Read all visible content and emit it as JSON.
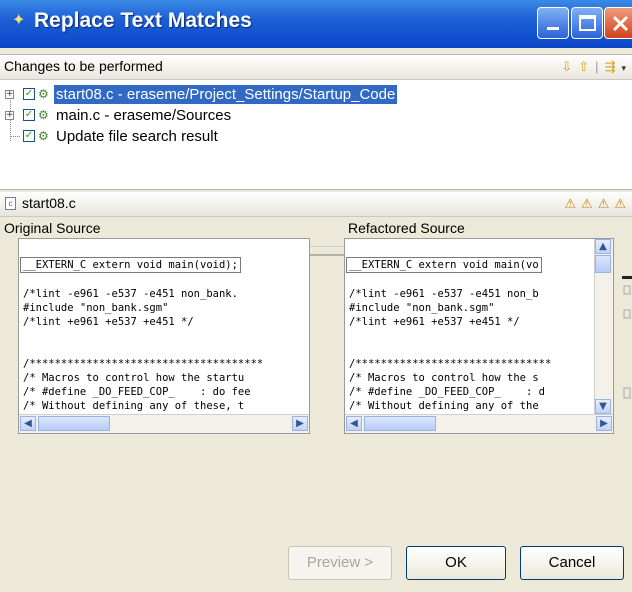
{
  "window": {
    "title": "Replace Text Matches"
  },
  "changes": {
    "header": "Changes to be performed",
    "items": [
      {
        "label": "start08.c - eraseme/Project_Settings/Startup_Code",
        "checked": true,
        "selected": true
      },
      {
        "label": "main.c - eraseme/Sources",
        "checked": true,
        "selected": false
      },
      {
        "label": "Update file search result",
        "checked": true,
        "selected": false
      }
    ]
  },
  "compare": {
    "file_name": "start08.c",
    "left_title": "Original Source",
    "right_title": "Refactored Source",
    "left_lines": [
      "__EXTERN_C extern void main(void);",
      "",
      "/*lint -e961 -e537 -e451 non_bank.",
      "#include \"non_bank.sgm\"",
      "/*lint +e961 +e537 +e451 */",
      "",
      "",
      "/*************************************",
      "/* Macros to control how the startu",
      "/* #define _DO_FEED_COP_    : do fee",
      "/* Without defining any of these, t",
      "/*************************************",
      "/"
    ],
    "right_lines": [
      "__EXTERN_C extern void main(vo",
      "",
      "/*lint -e961 -e537 -e451 non_b",
      "#include \"non_bank.sgm\"",
      "/*lint +e961 +e537 +e451 */",
      "",
      "",
      "/*******************************",
      "/* Macros to control how the s",
      "/* #define _DO_FEED_COP_    : d",
      "/* Without defining any of the",
      "/*******************************",
      "/"
    ]
  },
  "buttons": {
    "preview": "Preview >",
    "ok": "OK",
    "cancel": "Cancel"
  },
  "colors": {
    "title_blue": "#0a46c8",
    "selection": "#316ac5",
    "dialog_bg": "#ece9d8"
  }
}
